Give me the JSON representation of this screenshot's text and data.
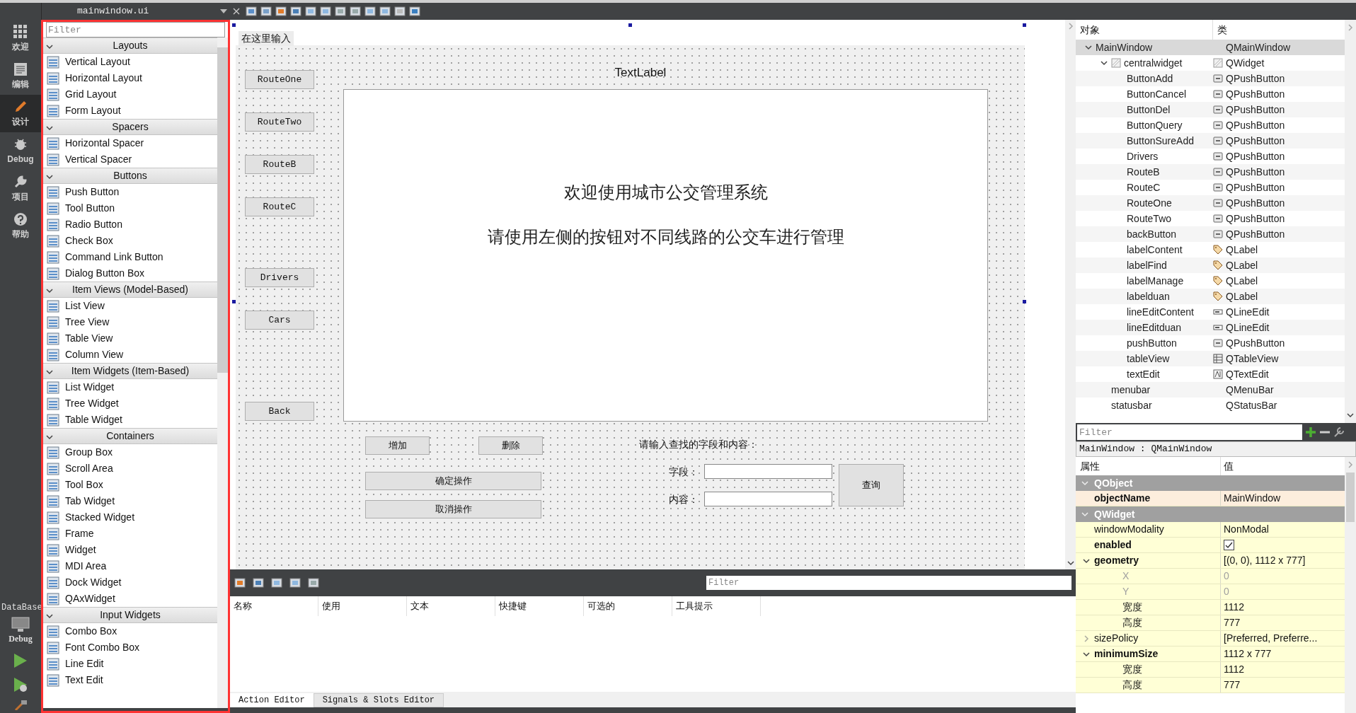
{
  "editor_tab": {
    "title": "mainwindow.ui"
  },
  "mode_bar": [
    {
      "label": "欢迎",
      "kind": "grid",
      "selected": false
    },
    {
      "label": "编辑",
      "kind": "doc",
      "selected": false
    },
    {
      "label": "设计",
      "kind": "pencil",
      "selected": true
    },
    {
      "label": "Debug",
      "kind": "bug",
      "selected": false
    },
    {
      "label": "项目",
      "kind": "wrench",
      "selected": false
    },
    {
      "label": "帮助",
      "kind": "help",
      "selected": false
    }
  ],
  "kit": {
    "project": "DataBase",
    "config": "Debug"
  },
  "widget_box": {
    "filter_placeholder": "Filter",
    "categories": [
      {
        "name": "Layouts",
        "expanded": true,
        "items": [
          "Vertical Layout",
          "Horizontal Layout",
          "Grid Layout",
          "Form Layout"
        ]
      },
      {
        "name": "Spacers",
        "expanded": true,
        "items": [
          "Horizontal Spacer",
          "Vertical Spacer"
        ]
      },
      {
        "name": "Buttons",
        "expanded": true,
        "items": [
          "Push Button",
          "Tool Button",
          "Radio Button",
          "Check Box",
          "Command Link Button",
          "Dialog Button Box"
        ]
      },
      {
        "name": "Item Views (Model-Based)",
        "expanded": true,
        "items": [
          "List View",
          "Tree View",
          "Table View",
          "Column View"
        ]
      },
      {
        "name": "Item Widgets (Item-Based)",
        "expanded": true,
        "items": [
          "List Widget",
          "Tree Widget",
          "Table Widget"
        ]
      },
      {
        "name": "Containers",
        "expanded": true,
        "items": [
          "Group Box",
          "Scroll Area",
          "Tool Box",
          "Tab Widget",
          "Stacked Widget",
          "Frame",
          "Widget",
          "MDI Area",
          "Dock Widget",
          "QAxWidget"
        ]
      },
      {
        "name": "Input Widgets",
        "expanded": true,
        "items": [
          "Combo Box",
          "Font Combo Box",
          "Line Edit",
          "Text Edit"
        ]
      }
    ]
  },
  "form": {
    "menu_placeholder": "在这里输入",
    "title_label": "TextLabel",
    "side_buttons": [
      "RouteOne",
      "RouteTwo",
      "RouteB",
      "RouteC",
      "Drivers",
      "Cars",
      "Back"
    ],
    "text_lines": [
      "欢迎使用城市公交管理系统",
      "请使用左侧的按钮对不同线路的公交车进行管理"
    ],
    "add_button": "增加",
    "delete_button": "删除",
    "confirm_button": "确定操作",
    "cancel_button": "取消操作",
    "search_prompt": "请输入查找的字段和内容：",
    "field_label": "字段：",
    "content_label": "内容：",
    "query_button": "查询"
  },
  "action_editor": {
    "filter_placeholder": "Filter",
    "columns": [
      "名称",
      "使用",
      "文本",
      "快捷键",
      "可选的",
      "工具提示"
    ],
    "tabs": [
      {
        "label": "Action Editor",
        "selected": true
      },
      {
        "label": "Signals & Slots Editor",
        "selected": false
      }
    ]
  },
  "object_inspector": {
    "columns": [
      "对象",
      "类"
    ],
    "tree": [
      {
        "name": "MainWindow",
        "class": "QMainWindow",
        "selected": true,
        "expanded": true,
        "children": [
          {
            "name": "centralwidget",
            "class": "QWidget",
            "kind": "widget",
            "selected": false,
            "expanded": true,
            "children": [
              {
                "name": "ButtonAdd",
                "class": "QPushButton",
                "kind": "button",
                "selected": false
              },
              {
                "name": "ButtonCancel",
                "class": "QPushButton",
                "kind": "button",
                "selected": false
              },
              {
                "name": "ButtonDel",
                "class": "QPushButton",
                "kind": "button",
                "selected": false
              },
              {
                "name": "ButtonQuery",
                "class": "QPushButton",
                "kind": "button",
                "selected": false
              },
              {
                "name": "ButtonSureAdd",
                "class": "QPushButton",
                "kind": "button",
                "selected": false
              },
              {
                "name": "Drivers",
                "class": "QPushButton",
                "kind": "button",
                "selected": false
              },
              {
                "name": "RouteB",
                "class": "QPushButton",
                "kind": "button",
                "selected": false
              },
              {
                "name": "RouteC",
                "class": "QPushButton",
                "kind": "button",
                "selected": false
              },
              {
                "name": "RouteOne",
                "class": "QPushButton",
                "kind": "button",
                "selected": false
              },
              {
                "name": "RouteTwo",
                "class": "QPushButton",
                "kind": "button",
                "selected": false
              },
              {
                "name": "backButton",
                "class": "QPushButton",
                "kind": "button",
                "selected": false
              },
              {
                "name": "labelContent",
                "class": "QLabel",
                "kind": "label",
                "selected": false
              },
              {
                "name": "labelFind",
                "class": "QLabel",
                "kind": "label",
                "selected": false
              },
              {
                "name": "labelManage",
                "class": "QLabel",
                "kind": "label",
                "selected": false
              },
              {
                "name": "labelduan",
                "class": "QLabel",
                "kind": "label",
                "selected": false
              },
              {
                "name": "lineEditContent",
                "class": "QLineEdit",
                "kind": "lineedit",
                "selected": false
              },
              {
                "name": "lineEditduan",
                "class": "QLineEdit",
                "kind": "lineedit",
                "selected": false
              },
              {
                "name": "pushButton",
                "class": "QPushButton",
                "kind": "button",
                "selected": false
              },
              {
                "name": "tableView",
                "class": "QTableView",
                "kind": "table",
                "selected": false
              },
              {
                "name": "textEdit",
                "class": "QTextEdit",
                "kind": "textedit",
                "selected": false
              }
            ]
          },
          {
            "name": "menubar",
            "class": "QMenuBar",
            "selected": false
          },
          {
            "name": "statusbar",
            "class": "QStatusBar",
            "selected": false
          }
        ]
      }
    ]
  },
  "property_editor": {
    "filter_placeholder": "Filter",
    "object": "MainWindow : QMainWindow",
    "columns": [
      "属性",
      "值"
    ],
    "rows": [
      {
        "kind": "group",
        "name": "QObject",
        "color": "#fdeedd",
        "expanded": true,
        "children": [
          {
            "kind": "text",
            "name": "objectName",
            "value": "MainWindow",
            "modified": true
          }
        ]
      },
      {
        "kind": "group",
        "name": "QWidget",
        "color": "#ffffd6",
        "expanded": true,
        "children": [
          {
            "kind": "text",
            "name": "windowModality",
            "value": "NonModal",
            "modified": false
          },
          {
            "kind": "checkbox",
            "name": "enabled",
            "checked": true,
            "modified": true
          },
          {
            "kind": "text",
            "name": "geometry",
            "value": "[(0, 0), 1112 x 777]",
            "modified": true,
            "expanded": true,
            "children": [
              {
                "kind": "text",
                "name": "X",
                "value": "0",
                "disabled": true
              },
              {
                "kind": "text",
                "name": "Y",
                "value": "0",
                "disabled": true
              },
              {
                "kind": "text",
                "name": "宽度",
                "value": "1112",
                "disabled": false
              },
              {
                "kind": "text",
                "name": "高度",
                "value": "777",
                "disabled": false
              }
            ]
          },
          {
            "kind": "text",
            "name": "sizePolicy",
            "value": "[Preferred, Preferre...",
            "modified": false,
            "expanded": false
          },
          {
            "kind": "text",
            "name": "minimumSize",
            "value": "1112 x 777",
            "modified": true,
            "expanded": true,
            "children": [
              {
                "kind": "text",
                "name": "宽度",
                "value": "1112",
                "disabled": false
              },
              {
                "kind": "text",
                "name": "高度",
                "value": "777",
                "disabled": false
              }
            ]
          }
        ]
      }
    ]
  }
}
